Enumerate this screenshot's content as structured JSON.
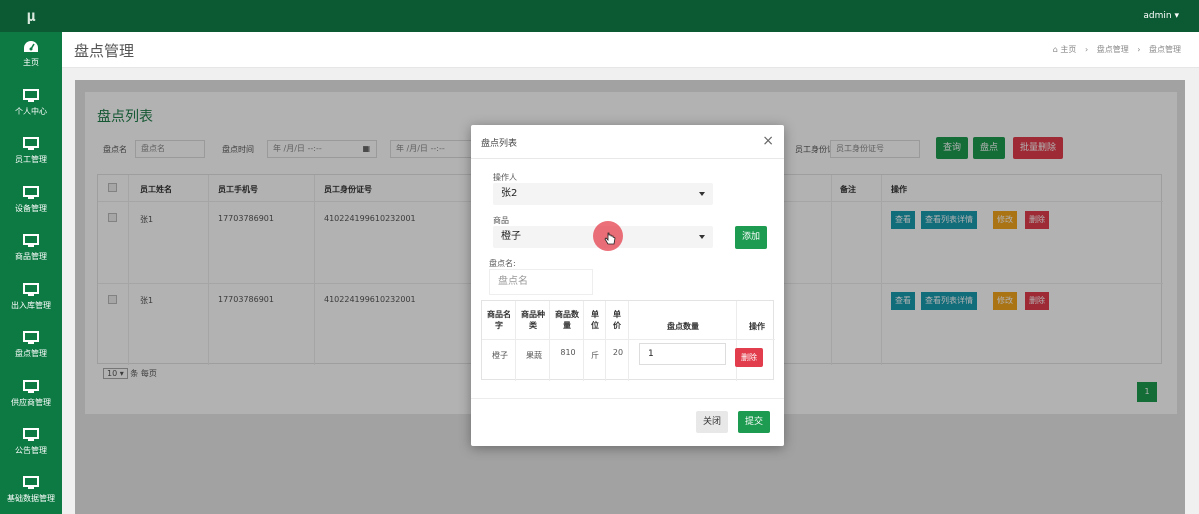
{
  "app": {
    "logo": "μ",
    "user": "admin"
  },
  "sidebar": {
    "items": [
      {
        "label": "主页",
        "icon": "dashboard-icon"
      },
      {
        "label": "个人中心",
        "icon": "monitor-icon"
      },
      {
        "label": "员工管理",
        "icon": "monitor-icon"
      },
      {
        "label": "设备管理",
        "icon": "monitor-icon"
      },
      {
        "label": "商品管理",
        "icon": "monitor-icon"
      },
      {
        "label": "出入库管理",
        "icon": "monitor-icon"
      },
      {
        "label": "盘点管理",
        "icon": "monitor-icon"
      },
      {
        "label": "供应商管理",
        "icon": "monitor-icon"
      },
      {
        "label": "公告管理",
        "icon": "monitor-icon"
      },
      {
        "label": "基础数据管理",
        "icon": "monitor-icon"
      }
    ]
  },
  "header": {
    "title": "盘点管理",
    "breadcrumb": [
      "主页",
      "盘点管理",
      "盘点管理"
    ]
  },
  "list": {
    "title": "盘点列表",
    "filters": {
      "name_label": "盘点名",
      "name_placeholder": "盘点名",
      "time_label": "盘点时间",
      "date_from": "年 /月/日 --:--",
      "date_to": "年 /月/日 --:--",
      "id_label": "员工身份证号",
      "id_placeholder": "员工身份证号"
    },
    "actions": {
      "query": "查询",
      "inventory": "盘点",
      "batch_delete": "批量删除"
    },
    "columns": [
      "员工姓名",
      "员工手机号",
      "员工身份证号",
      "备注",
      "操作"
    ],
    "rows": [
      {
        "name": "张1",
        "phone": "17703786901",
        "idno": "410224199610232001"
      },
      {
        "name": "张1",
        "phone": "17703786901",
        "idno": "410224199610232001"
      }
    ],
    "row_actions": {
      "view": "查看",
      "view_detail": "查看列表详情",
      "edit": "修改",
      "delete": "删除"
    },
    "pager": {
      "page_size": "10",
      "per_page": "条 每页",
      "current": "1"
    }
  },
  "modal": {
    "title": "盘点列表",
    "close": "×",
    "operator_label": "操作人",
    "operator_value": "张2",
    "goods_label": "商品",
    "goods_value": "橙子",
    "add": "添加",
    "name_label": "盘点名:",
    "name_placeholder": "盘点名",
    "table": {
      "headers": [
        "商品名字",
        "商品种类",
        "商品数量",
        "单位",
        "单价",
        "盘点数量",
        "操作"
      ],
      "row": {
        "name": "橙子",
        "category": "果蔬",
        "count": "810",
        "unit": "斤",
        "price": "20",
        "qty": "1",
        "delete": "删除"
      }
    },
    "close_btn": "关闭",
    "submit": "提交"
  },
  "colors": {
    "topbar": "#0b5a33",
    "sidebar": "#0d7a43",
    "accent": "#1d9b50",
    "danger": "#e23d4c",
    "info": "#1a9db0",
    "warning": "#f4a61f"
  }
}
